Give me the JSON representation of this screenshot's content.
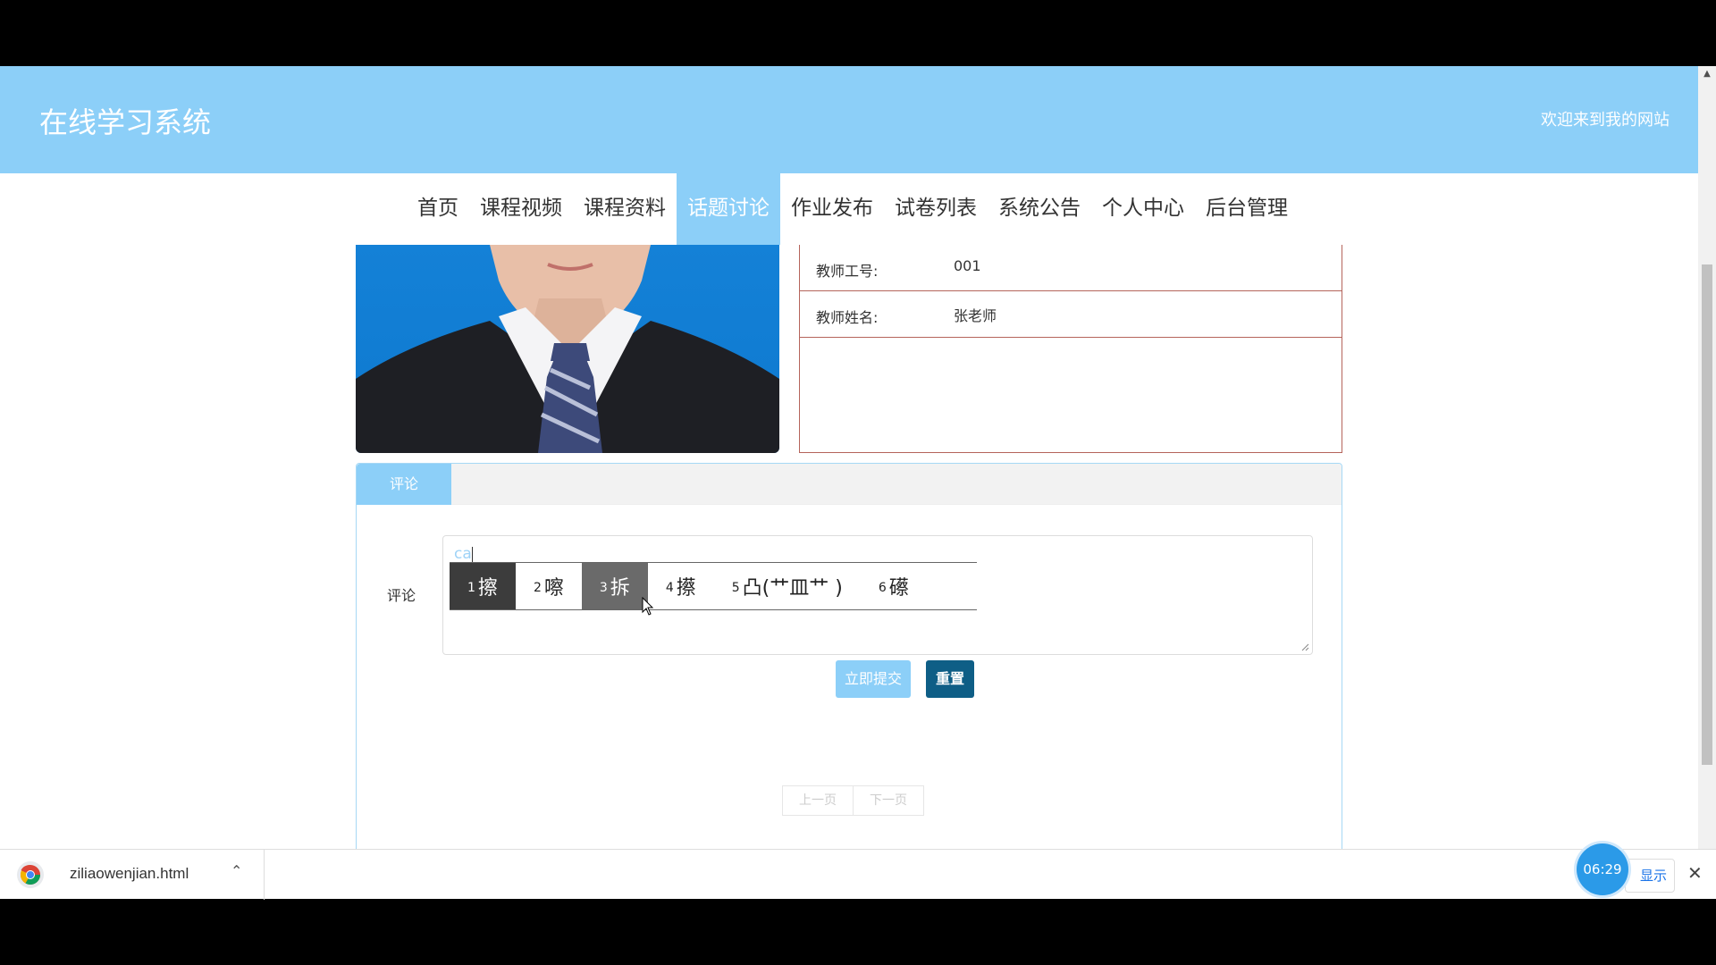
{
  "header": {
    "site_title": "在线学习系统",
    "welcome": "欢迎来到我的网站"
  },
  "nav": {
    "items": [
      "首页",
      "课程视频",
      "课程资料",
      "话题讨论",
      "作业发布",
      "试卷列表",
      "系统公告",
      "个人中心",
      "后台管理"
    ],
    "active": "话题讨论"
  },
  "teacher": {
    "id_label": "教师工号:",
    "id_value": "001",
    "name_label": "教师姓名:",
    "name_value": "张老师"
  },
  "comments": {
    "tab_label": "评论",
    "field_label": "评论",
    "typed_text": "ca",
    "submit_label": "立即提交",
    "reset_label": "重置",
    "prev_label": "上一页",
    "next_label": "下一页"
  },
  "ime": {
    "candidates": [
      {
        "num": "1",
        "text": "擦"
      },
      {
        "num": "2",
        "text": "嚓"
      },
      {
        "num": "3",
        "text": "拆"
      },
      {
        "num": "4",
        "text": "攃"
      },
      {
        "num": "5",
        "text": "凸(艹皿艹 )"
      },
      {
        "num": "6",
        "text": "礤"
      }
    ],
    "selected_index": 0,
    "hover_index": 2
  },
  "download_bar": {
    "file_name": "ziliaowenjian.html",
    "show_all_label": "显示",
    "timer": "06:29"
  },
  "colors": {
    "primary": "#8ccff8",
    "reset": "#0e5e86",
    "border_red": "#b5645b"
  }
}
